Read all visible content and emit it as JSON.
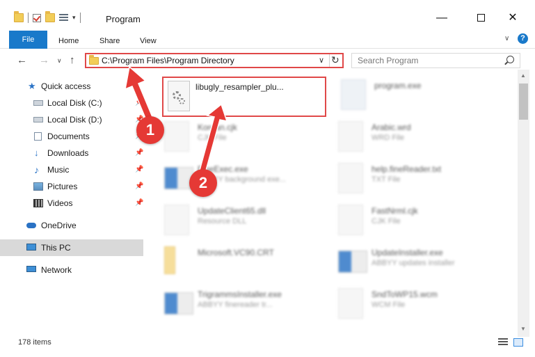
{
  "window": {
    "title": "Program",
    "minimize_glyph": "—",
    "close_glyph": "✕",
    "qat_drop": "▾"
  },
  "ribbon": {
    "tabs": [
      "File",
      "Home",
      "Share",
      "View"
    ],
    "chevron": "∨",
    "help": "?"
  },
  "nav": {
    "back": "←",
    "forward": "→",
    "recent": "∨",
    "up": "↑",
    "address": "C:\\Program Files\\Program Directory",
    "address_drop": "∨",
    "refresh": "↻",
    "search_placeholder": "Search Program"
  },
  "sidebar": {
    "items": [
      {
        "label": "Quick access",
        "icon": "star-icon",
        "pinned": false
      },
      {
        "label": "Local Disk (C:)",
        "icon": "drive-icon",
        "pinned": true
      },
      {
        "label": "Local Disk (D:)",
        "icon": "drive-icon",
        "pinned": true
      },
      {
        "label": "Documents",
        "icon": "documents-icon",
        "pinned": true
      },
      {
        "label": "Downloads",
        "icon": "download-icon",
        "pinned": true
      },
      {
        "label": "Music",
        "icon": "music-icon",
        "pinned": true
      },
      {
        "label": "Pictures",
        "icon": "pictures-icon",
        "pinned": true
      },
      {
        "label": "Videos",
        "icon": "videos-icon",
        "pinned": true
      },
      {
        "label": "OneDrive",
        "icon": "cloud-icon",
        "pinned": false
      },
      {
        "label": "This PC",
        "icon": "computer-icon",
        "pinned": false,
        "selected": true
      },
      {
        "label": "Network",
        "icon": "network-icon",
        "pinned": false
      }
    ],
    "pin_glyph": "📌"
  },
  "files": {
    "highlighted": {
      "name": "libugly_resampler_plu..."
    },
    "items": [
      {
        "name": "program.exe",
        "type": ""
      },
      {
        "name": "Korean.cjk",
        "type": "CJK File"
      },
      {
        "name": "Arabic.wrd",
        "type": "WRD File"
      },
      {
        "name": "FineExec.exe",
        "type": "ABBYY background exe..."
      },
      {
        "name": "help.fineReader.txt",
        "type": "TXT File"
      },
      {
        "name": "UpdateClient65.dll",
        "type": "Resource DLL"
      },
      {
        "name": "FastNrml.cjk",
        "type": "CJK File"
      },
      {
        "name": "Microsoft.VC90.CRT",
        "type": ""
      },
      {
        "name": "UpdateInstaller.exe",
        "type": "ABBYY updates installer"
      },
      {
        "name": "TrigrammsInstaller.exe",
        "type": "ABBYY finereader tr..."
      },
      {
        "name": "SndToWP15.wcm",
        "type": "WCM File"
      }
    ]
  },
  "status": {
    "item_count": "178 items"
  },
  "annotations": {
    "step1": "1",
    "step2": "2"
  },
  "colors": {
    "accent": "#1979ca",
    "highlight": "#e04848",
    "arrow": "#e53935"
  }
}
